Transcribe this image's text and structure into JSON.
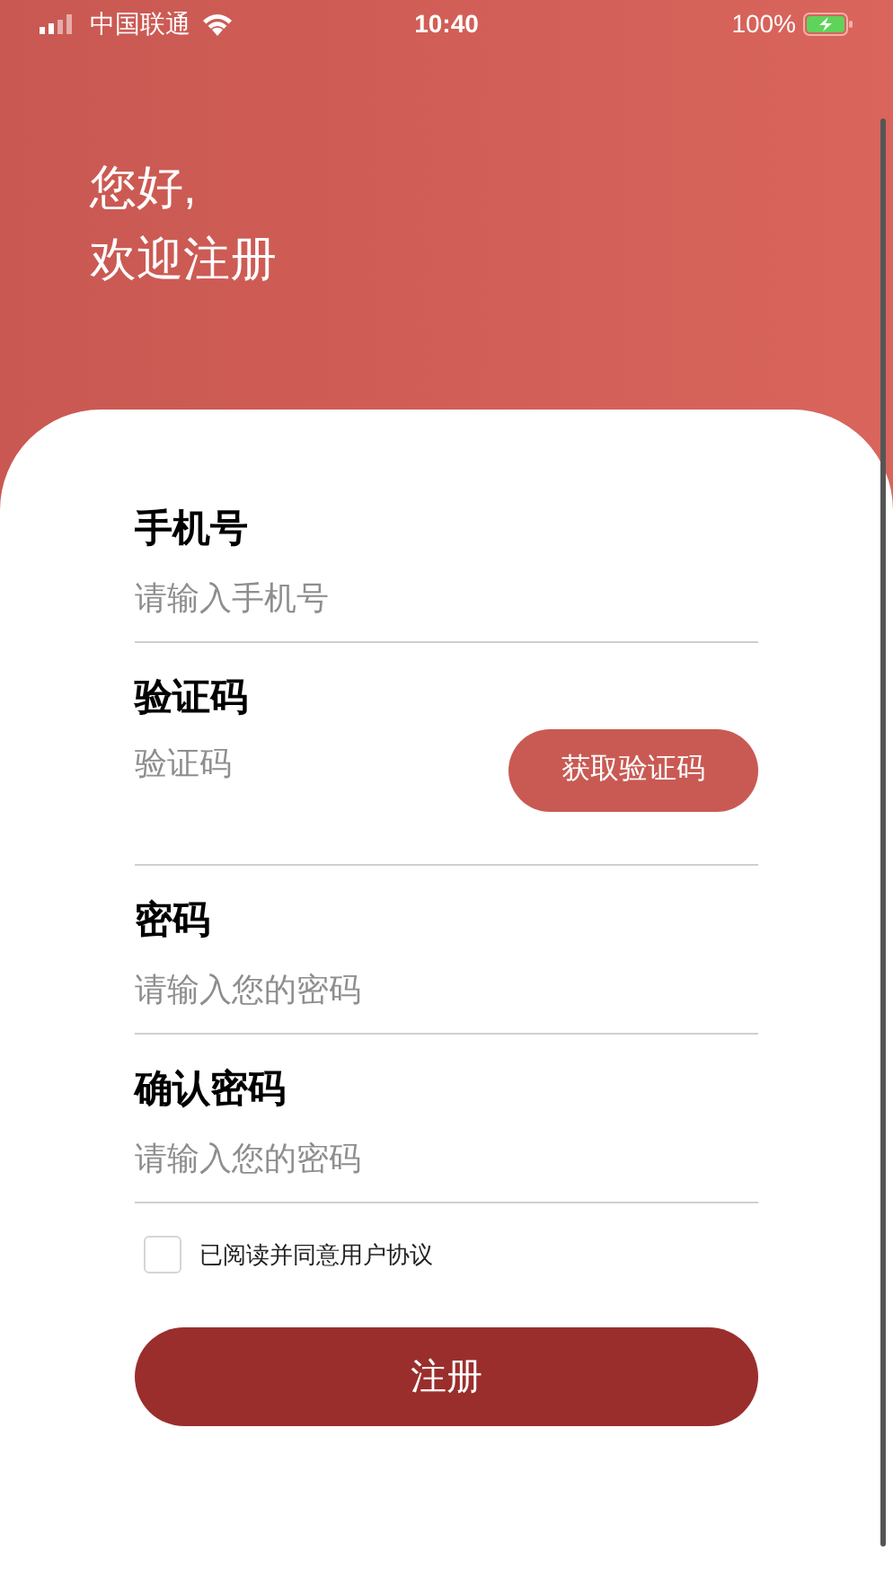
{
  "status_bar": {
    "carrier": "中国联通",
    "time": "10:40",
    "battery": "100%"
  },
  "greeting": [
    "您好,",
    "欢迎注册"
  ],
  "fields": [
    {
      "label": "手机号",
      "placeholder": "请输入手机号",
      "kind": "text"
    },
    {
      "label": "验证码",
      "placeholder": "验证码",
      "kind": "code",
      "button": "获取验证码"
    },
    {
      "label": "密码",
      "placeholder": "请输入您的密码",
      "kind": "password"
    },
    {
      "label": "确认密码",
      "placeholder": "请输入您的密码",
      "kind": "password"
    }
  ],
  "agreement": {
    "label": "已阅读并同意用户协议",
    "checked": false
  },
  "submit": "注册"
}
